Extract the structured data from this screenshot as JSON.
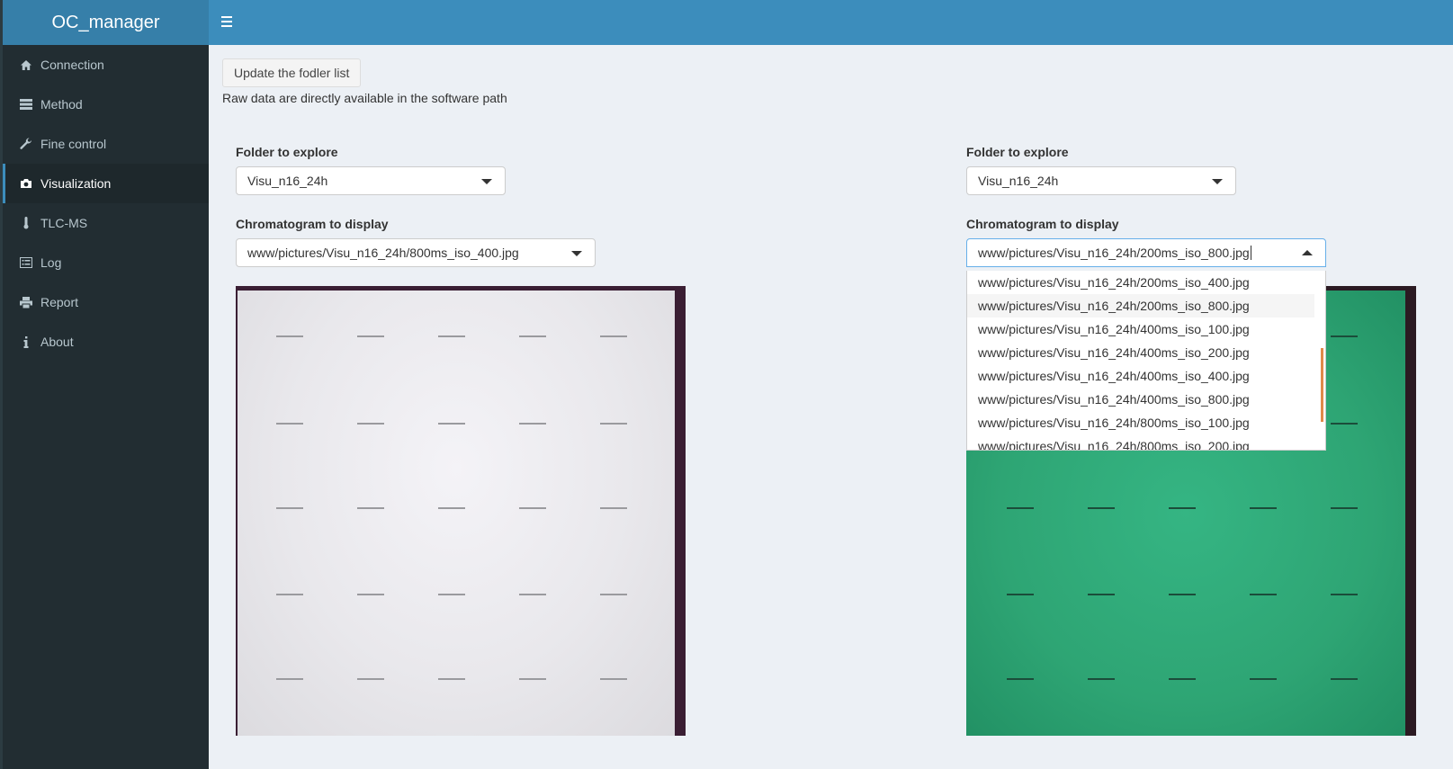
{
  "app": {
    "title": "OC_manager"
  },
  "sidebar": {
    "items": [
      {
        "label": "Connection",
        "icon": "home-icon",
        "active": false
      },
      {
        "label": "Method",
        "icon": "server-icon",
        "active": false
      },
      {
        "label": "Fine control",
        "icon": "wrench-icon",
        "active": false
      },
      {
        "label": "Visualization",
        "icon": "camera-icon",
        "active": true
      },
      {
        "label": "TLC-MS",
        "icon": "thermometer-icon",
        "active": false
      },
      {
        "label": "Log",
        "icon": "list-alt-icon",
        "active": false
      },
      {
        "label": "Report",
        "icon": "print-icon",
        "active": false
      },
      {
        "label": "About",
        "icon": "info-icon",
        "active": false
      }
    ]
  },
  "main": {
    "update_button": "Update the fodler list",
    "note": "Raw data are directly available in the software path",
    "left": {
      "folder_label": "Folder to explore",
      "folder_value": "Visu_n16_24h",
      "chrom_label": "Chromatogram to display",
      "chrom_value": "www/pictures/Visu_n16_24h/800ms_iso_400.jpg"
    },
    "right": {
      "folder_label": "Folder to explore",
      "folder_value": "Visu_n16_24h",
      "chrom_label": "Chromatogram to display",
      "chrom_value": "www/pictures/Visu_n16_24h/200ms_iso_800.jpg",
      "dropdown_options": [
        "www/pictures/Visu_n16_24h/200ms_iso_400.jpg",
        "www/pictures/Visu_n16_24h/200ms_iso_800.jpg",
        "www/pictures/Visu_n16_24h/400ms_iso_100.jpg",
        "www/pictures/Visu_n16_24h/400ms_iso_200.jpg",
        "www/pictures/Visu_n16_24h/400ms_iso_400.jpg",
        "www/pictures/Visu_n16_24h/400ms_iso_800.jpg",
        "www/pictures/Visu_n16_24h/800ms_iso_100.jpg",
        "www/pictures/Visu_n16_24h/800ms_iso_200.jpg"
      ],
      "highlighted_option": 1
    }
  },
  "colors": {
    "header": "#3c8dbc",
    "logo_bg": "#367fa9",
    "sidebar": "#222d32",
    "content_bg": "#ecf0f5",
    "plate_green": "#2ea574"
  }
}
